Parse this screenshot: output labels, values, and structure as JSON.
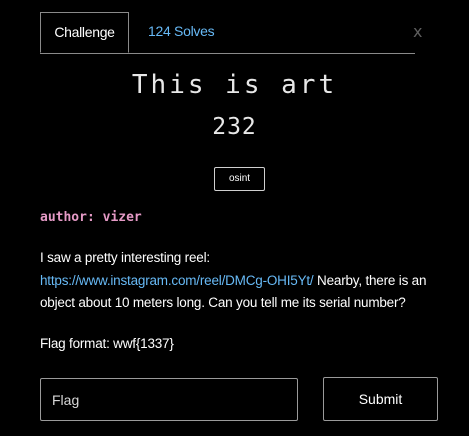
{
  "tabs": {
    "challenge_label": "Challenge",
    "solves_label": "124 Solves",
    "close_label": "x"
  },
  "challenge": {
    "title": "This is art",
    "points": "232",
    "tag": "osint",
    "author": "author: vizer",
    "description_intro": "I saw a pretty interesting reel:",
    "description_link": "https://www.instagram.com/reel/DMCg-OHI5Yt/",
    "description_rest": " Nearby, there is an object about 10 meters long. Can you tell me its serial number?",
    "flag_format": "Flag format: wwf{1337}"
  },
  "form": {
    "flag_placeholder": "Flag",
    "submit_label": "Submit"
  },
  "colors": {
    "background": "#000000",
    "link": "#67b9f5",
    "author": "#e59ac6"
  }
}
